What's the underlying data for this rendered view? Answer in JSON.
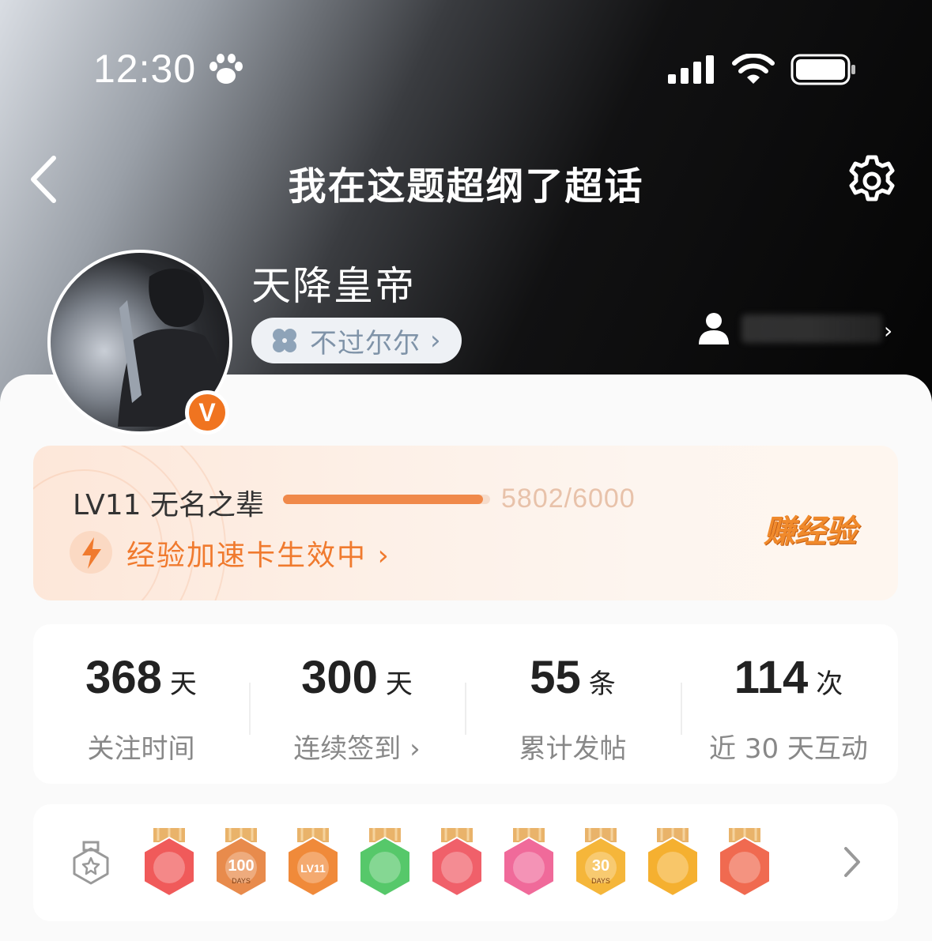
{
  "status_bar": {
    "time": "12:30"
  },
  "nav": {
    "title": "我在这题超纲了超话"
  },
  "profile": {
    "username": "天降皇帝",
    "tag": "不过尔尔",
    "verified_mark": "V"
  },
  "level": {
    "label": "LV11 无名之辈",
    "progress_text": "5802/6000",
    "progress_fraction": 0.967,
    "boost_text": "经验加速卡生效中",
    "earn_button": "赚经验"
  },
  "stats": [
    {
      "value": "368",
      "unit": "天",
      "caption": "关注时间"
    },
    {
      "value": "300",
      "unit": "天",
      "caption": "连续签到 ›"
    },
    {
      "value": "55",
      "unit": "条",
      "caption": "累计发帖"
    },
    {
      "value": "114",
      "unit": "次",
      "caption": "近 30 天互动"
    }
  ],
  "badges": [
    {
      "icon": "unicorn-badge",
      "color": "#f05a5a"
    },
    {
      "icon": "100-days-badge",
      "color": "#e88b4c",
      "text": "100",
      "sub": "DAYS"
    },
    {
      "icon": "lv11-badge",
      "color": "#f08a3a",
      "text": "LV11"
    },
    {
      "icon": "hand-badge",
      "color": "#56c86a"
    },
    {
      "icon": "trophy-badge",
      "color": "#f0606a"
    },
    {
      "icon": "graduation-cap-badge",
      "color": "#f06a9a"
    },
    {
      "icon": "30-days-badge",
      "color": "#f5b63a",
      "text": "30",
      "sub": "DAYS"
    },
    {
      "icon": "cheering-face-badge",
      "color": "#f5b030"
    },
    {
      "icon": "rock-hand-badge",
      "color": "#f06a50"
    }
  ],
  "colors": {
    "accent": "#f07a2e",
    "badge_orange": "#f07420"
  }
}
